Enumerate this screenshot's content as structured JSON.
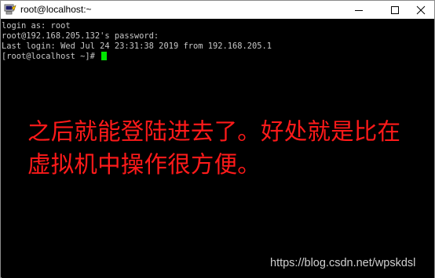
{
  "window": {
    "title": "root@localhost:~",
    "icon": "putty-terminal-icon"
  },
  "controls": {
    "minimize": "minimize-icon",
    "maximize": "maximize-icon",
    "close": "close-icon"
  },
  "terminal": {
    "lines": [
      "login as: root",
      "root@192.168.205.132's password:",
      "Last login: Wed Jul 24 23:31:38 2019 from 192.168.205.1",
      "[root@localhost ~]# "
    ],
    "cursor_color": "#00e600",
    "text_color": "#c8c8c8",
    "background": "#000000"
  },
  "annotation": {
    "line1": "之后就能登陆进去了。好处就是比在",
    "line2": "虚拟机中操作很方便。",
    "color": "#ff1a1a"
  },
  "watermark": {
    "text": "https://blog.csdn.net/wpskdsl"
  }
}
